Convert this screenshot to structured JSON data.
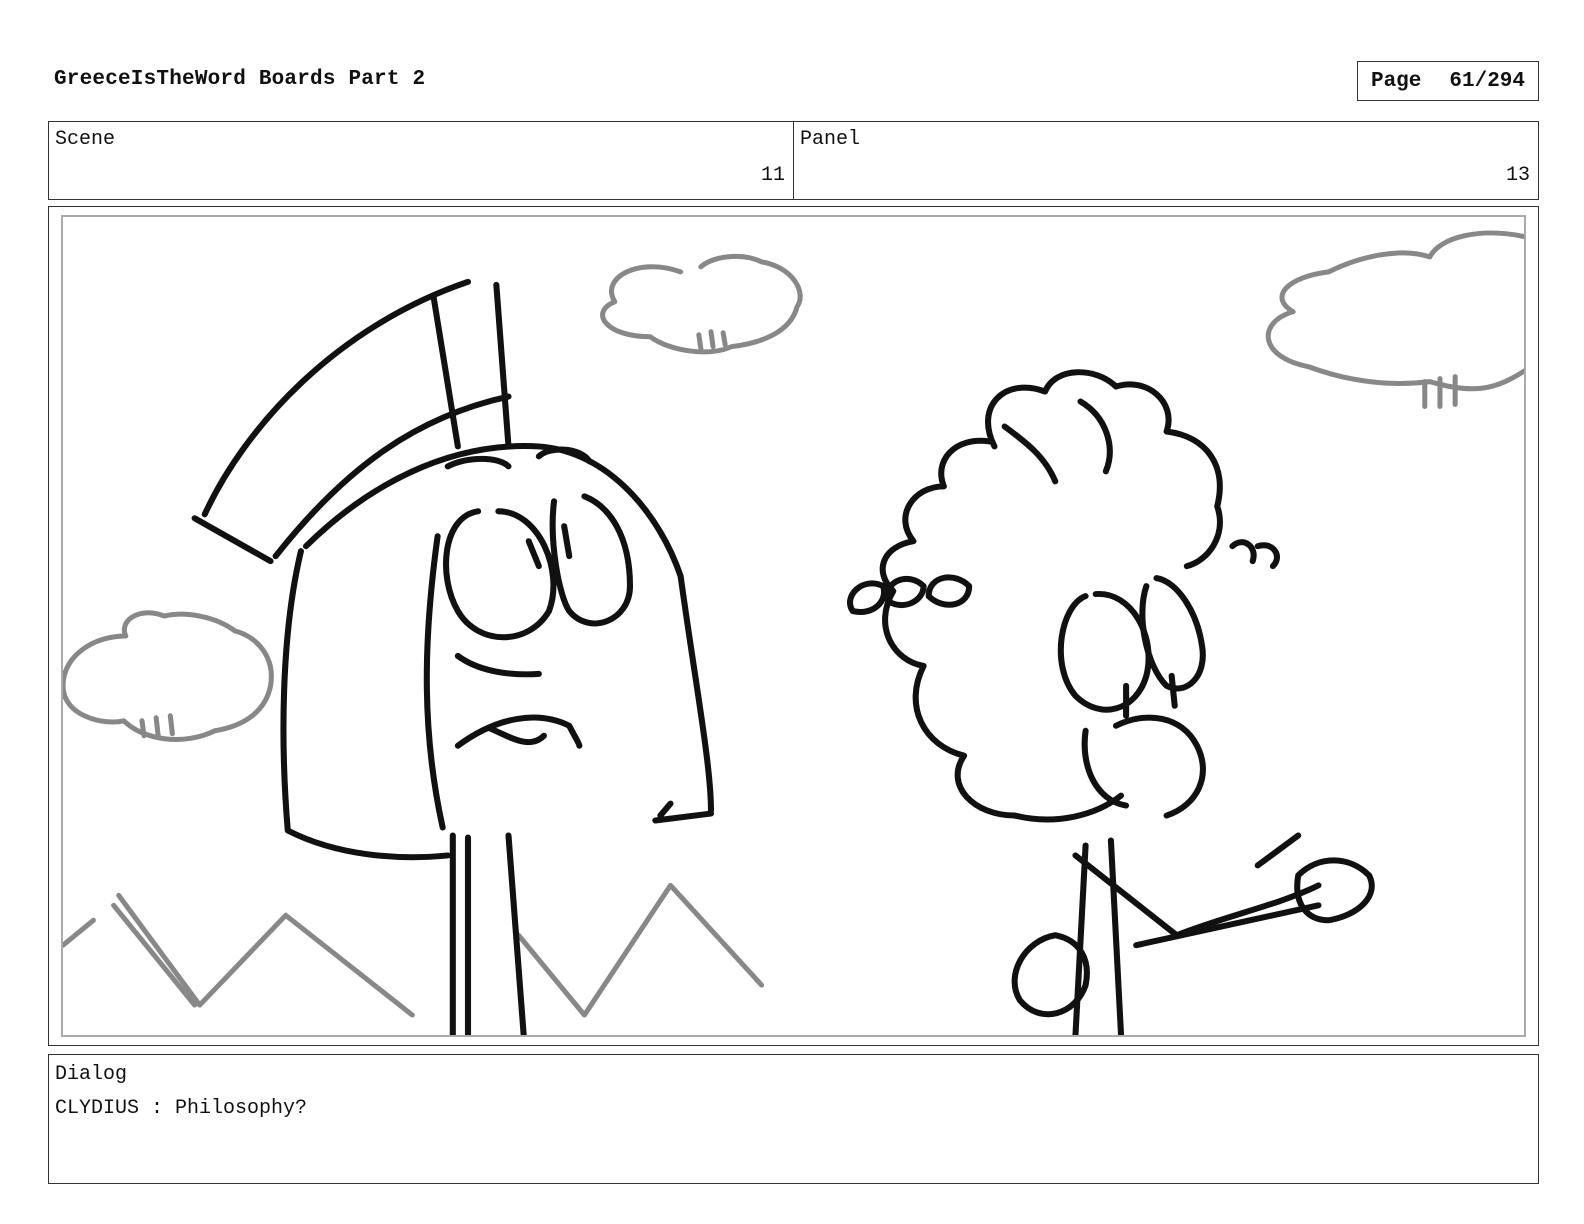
{
  "header": {
    "title": "GreeceIsTheWord Boards Part 2",
    "page_label": "Page",
    "page_value": "61/294"
  },
  "scene": {
    "label": "Scene",
    "value": "11"
  },
  "panel": {
    "label": "Panel",
    "value": "13"
  },
  "dialog": {
    "label": "Dialog",
    "line": "CLYDIUS : Philosophy?"
  },
  "drawing": {
    "line_color": "#111111",
    "background_color": "#888888"
  }
}
